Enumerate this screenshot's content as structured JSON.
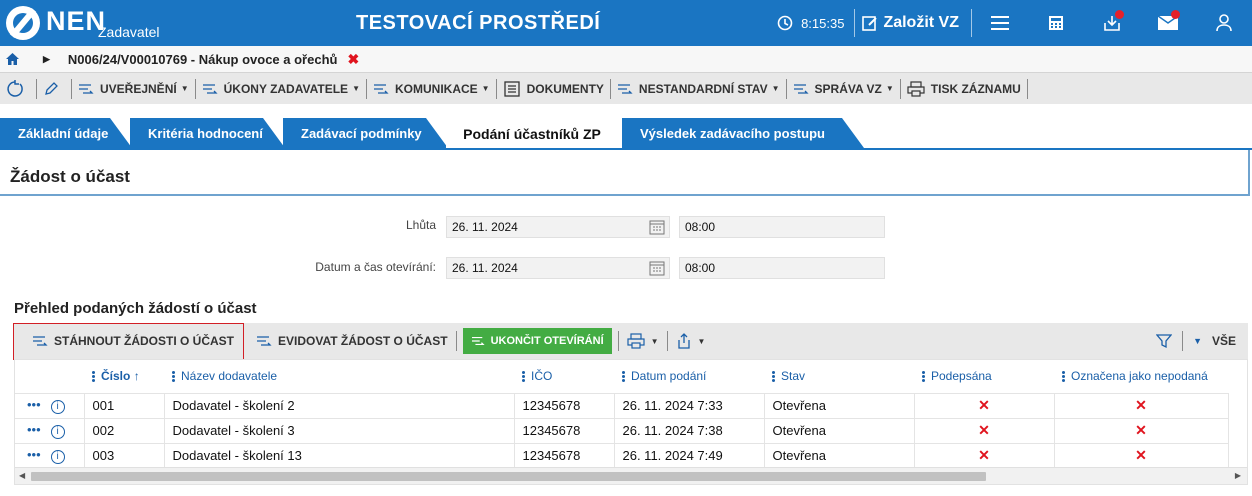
{
  "header": {
    "logo": "NEN",
    "logo_sub": "Zadavatel",
    "env_title": "TESTOVACÍ PROSTŘEDÍ",
    "time": "8:15:35",
    "new_vz": "Založit VZ",
    "accent": "#1a75c2"
  },
  "breadcrumb": {
    "title": "N006/24/V00010769 - Nákup ovoce a ořechů"
  },
  "toolbar": {
    "items": [
      "UVEŘEJNĚNÍ",
      "ÚKONY ZADAVATELE",
      "KOMUNIKACE",
      "DOKUMENTY",
      "NESTANDARDNÍ STAV",
      "SPRÁVA VZ",
      "TISK ZÁZNAMU"
    ]
  },
  "tabs": [
    {
      "label": "Základní údaje"
    },
    {
      "label": "Kritéria hodnocení"
    },
    {
      "label": "Zadávací podmínky"
    },
    {
      "label": "Podání účastníků ZP",
      "active": true
    },
    {
      "label": "Výsledek zadávacího postupu"
    }
  ],
  "section": {
    "title": "Žádost o účast",
    "deadline_label": "Lhůta",
    "deadline_date": "26. 11. 2024",
    "deadline_time": "08:00",
    "opening_label": "Datum a čas otevírání:",
    "opening_date": "26. 11. 2024",
    "opening_time": "08:00"
  },
  "overview": {
    "title": "Přehled podaných žádostí o účast",
    "btn_download": "STÁHNOUT ŽÁDOSTI O ÚČAST",
    "btn_register": "EVIDOVAT ŽÁDOST O ÚČAST",
    "btn_finish": "UKONČIT OTEVÍRÁNÍ",
    "filter_all": "VŠE"
  },
  "table": {
    "columns": [
      "Číslo",
      "Název dodavatele",
      "IČO",
      "Datum podání",
      "Stav",
      "Podepsána",
      "Označena jako nepodaná"
    ],
    "rows": [
      {
        "cislo": "001",
        "nazev": "Dodavatel - školení 2",
        "ico": "12345678",
        "datum": "26. 11. 2024 7:33",
        "stav": "Otevřena",
        "podepsana": "✕",
        "nepodana": "✕"
      },
      {
        "cislo": "002",
        "nazev": "Dodavatel - školení 3",
        "ico": "12345678",
        "datum": "26. 11. 2024 7:38",
        "stav": "Otevřena",
        "podepsana": "✕",
        "nepodana": "✕"
      },
      {
        "cislo": "003",
        "nazev": "Dodavatel - školení 13",
        "ico": "12345678",
        "datum": "26. 11. 2024 7:49",
        "stav": "Otevřena",
        "podepsana": "✕",
        "nepodana": "✕"
      }
    ]
  }
}
